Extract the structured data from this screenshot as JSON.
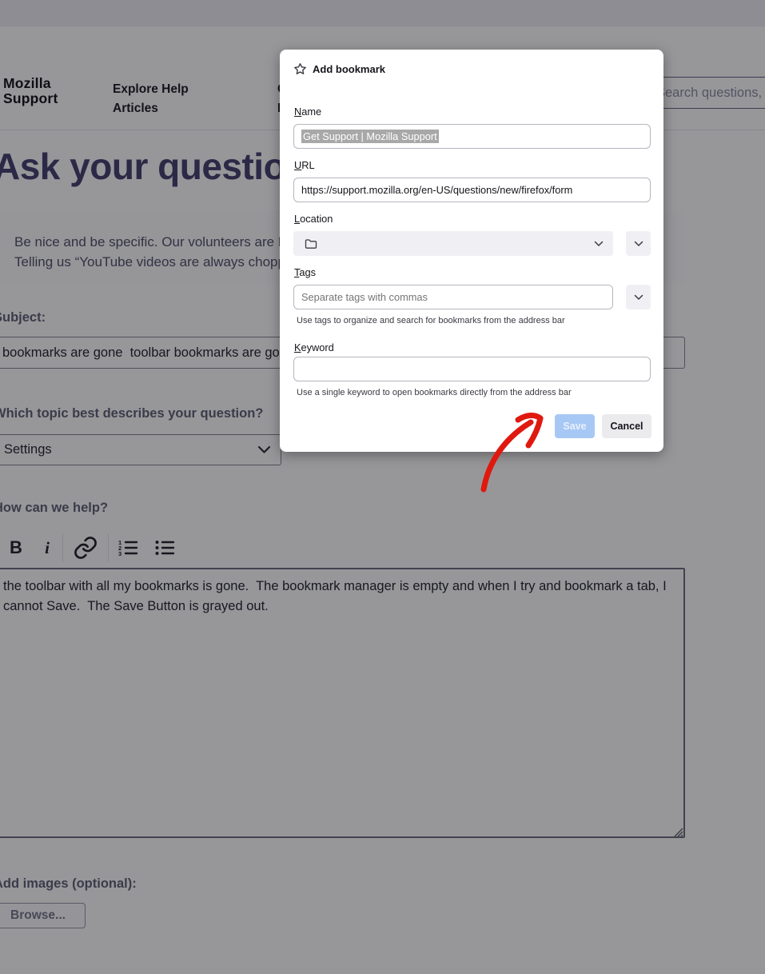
{
  "header": {
    "logo_line1": "Mozilla",
    "logo_line2": "Support",
    "nav_explore_line1": "Explore Help",
    "nav_explore_line2": "Articles",
    "nav_community_line1": "Community",
    "nav_community_line2": "Forums",
    "search_placeholder": "Search questions,"
  },
  "main": {
    "heading": "Ask your question",
    "tip_line1": "Be nice and be specific. Our volunteers are Mozilla users.",
    "tip_line2": "Telling us “YouTube videos are always choppy” is more helpful.",
    "subject_label": "Subject:",
    "subject_value": "bookmarks are gone  toolbar bookmarks are gone",
    "topic_label": "Which topic best describes your question?",
    "topic_value": "Settings",
    "help_label": "How can we help?",
    "toolbar": {
      "bold": "B",
      "italic": "i"
    },
    "editor_text": "the toolbar with all my bookmarks is gone.  The bookmark manager is empty and when I try and bookmark a tab, I cannot Save.  The Save Button is grayed out.",
    "images_label": "Add images (optional):",
    "browse_label": "Browse..."
  },
  "dialog": {
    "title": "Add bookmark",
    "name_label": "Name",
    "name_value": "Get Support | Mozilla Support",
    "url_label": "URL",
    "url_value": "https://support.mozilla.org/en-US/questions/new/firefox/form",
    "location_label": "Location",
    "tags_label": "Tags",
    "tags_placeholder": "Separate tags with commas",
    "tags_helper": "Use tags to organize and search for bookmarks from the address bar",
    "keyword_label": "Keyword",
    "keyword_value": "",
    "keyword_helper": "Use a single keyword to open bookmarks directly from the address bar",
    "save_label": "Save",
    "cancel_label": "Cancel"
  },
  "colors": {
    "overlay": "rgba(15,15,22,0.43)",
    "annotation_arrow": "#e0190f",
    "save_disabled_bg": "#a7c8f4",
    "save_disabled_text": "#e9f0fb",
    "cancel_bg": "#ebebee",
    "dialog_control_bg": "#f0f0f4",
    "heading": "#443f6d",
    "name_selection_bg": "#a8a8a8"
  }
}
